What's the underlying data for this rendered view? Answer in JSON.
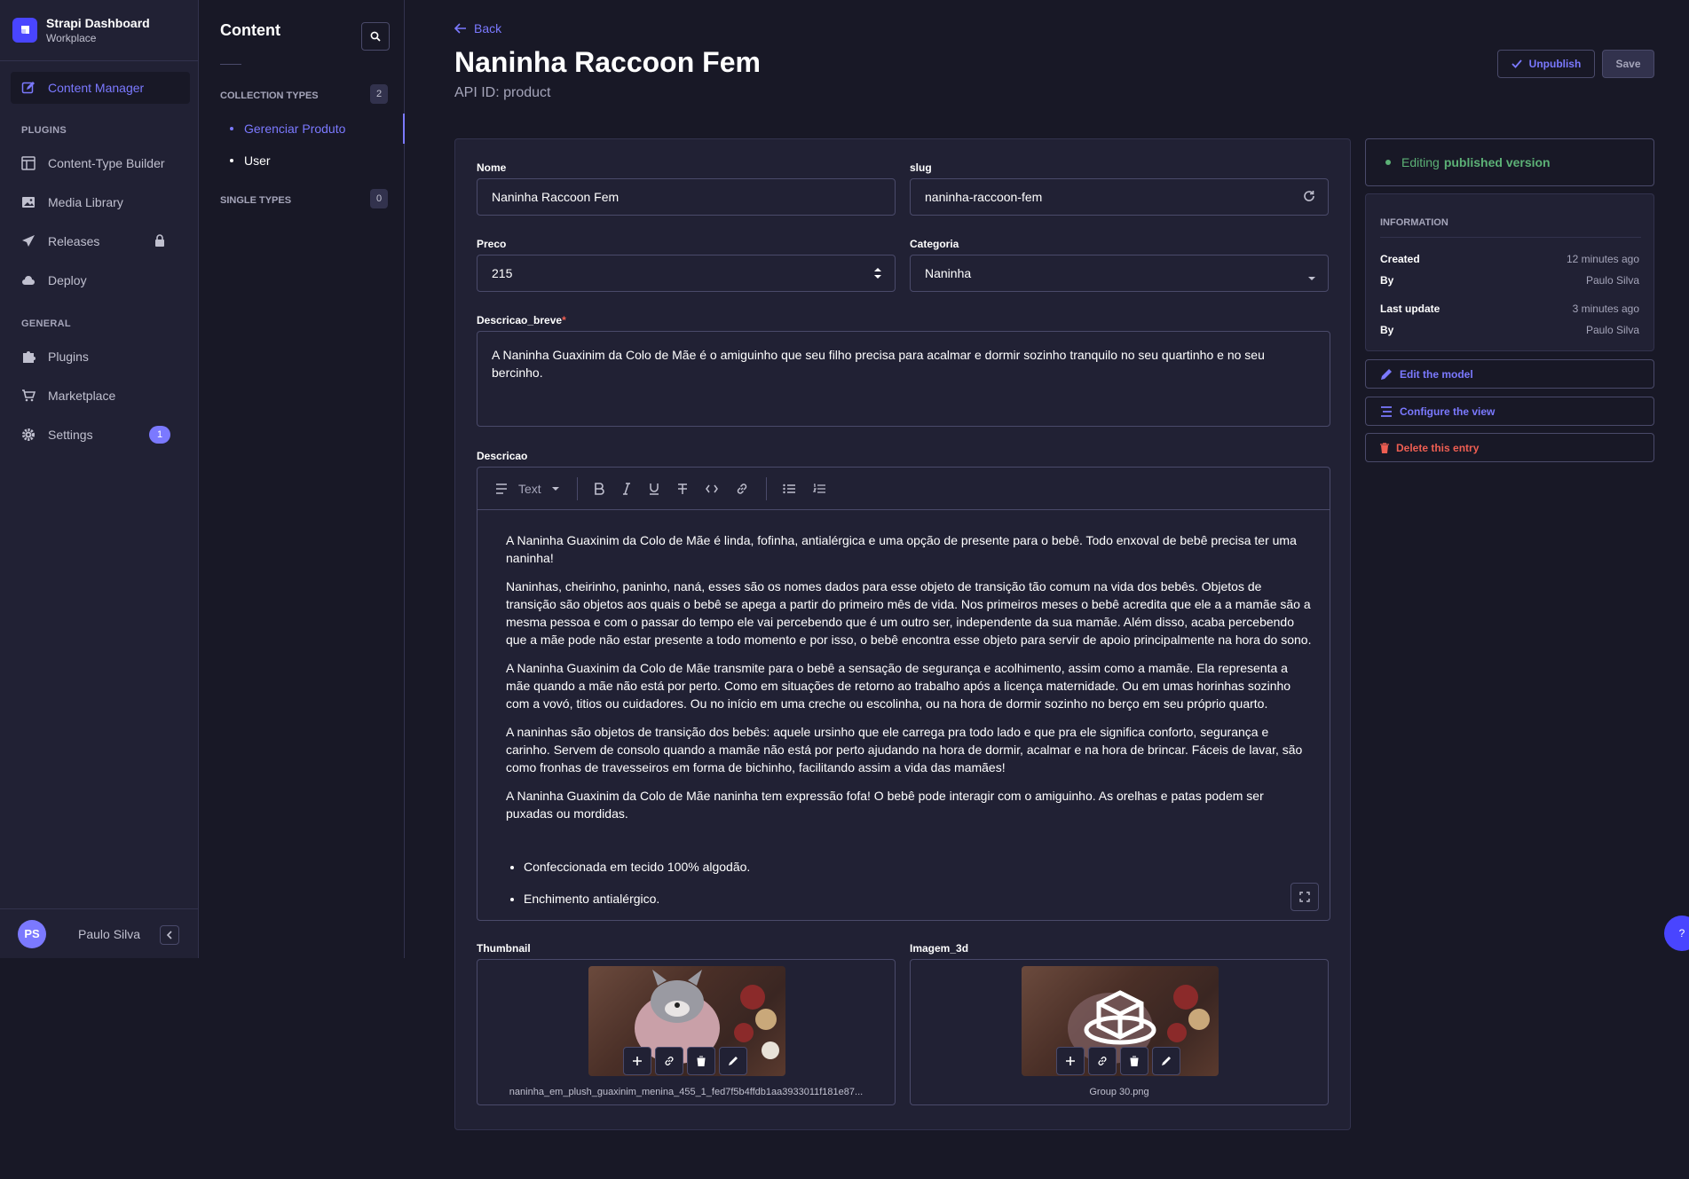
{
  "brand": {
    "title": "Strapi Dashboard",
    "subtitle": "Workplace"
  },
  "mainnav": {
    "content_manager": "Content Manager",
    "plugins_section": "PLUGINS",
    "ctb": "Content-Type Builder",
    "media": "Media Library",
    "releases": "Releases",
    "deploy": "Deploy",
    "general_section": "GENERAL",
    "plugins": "Plugins",
    "marketplace": "Marketplace",
    "settings": "Settings",
    "settings_badge": "1",
    "user_initials": "PS",
    "user_name": "Paulo Silva"
  },
  "subnav": {
    "title": "Content",
    "collection_types": "COLLECTION TYPES",
    "collection_count": "2",
    "items": [
      "Gerenciar Produto",
      "User"
    ],
    "single_types": "SINGLE TYPES",
    "single_count": "0"
  },
  "header": {
    "back": "Back",
    "title": "Naninha Raccoon Fem",
    "api_id": "API ID: product",
    "unpublish": "Unpublish",
    "save": "Save"
  },
  "form": {
    "nome_label": "Nome",
    "nome_value": "Naninha Raccoon Fem",
    "slug_label": "slug",
    "slug_value": "naninha-raccoon-fem",
    "preco_label": "Preco",
    "preco_value": "215",
    "categoria_label": "Categoria",
    "categoria_value": "Naninha",
    "descricao_breve_label": "Descricao_breve",
    "required_mark": "*",
    "descricao_breve_value": "A Naninha Guaxinim da Colo de Mãe é o amiguinho que seu filho precisa para acalmar e dormir sozinho tranquilo no seu quartinho e no seu bercinho.",
    "descricao_label": "Descricao",
    "toolbar_text": "Text",
    "paragraphs": [
      "A Naninha Guaxinim da Colo de Mãe é linda, fofinha, antialérgica e uma opção de presente para o bebê. Todo enxoval de bebê precisa ter uma naninha!",
      "Naninhas, cheirinho, paninho, naná, esses são os nomes dados para esse objeto de transição tão comum na vida dos bebês. Objetos de transição são objetos aos quais o bebê se apega a partir do primeiro mês de vida. Nos primeiros meses o bebê acredita que ele a a mamãe são a mesma pessoa e com o passar do tempo ele vai percebendo que é um outro ser, independente da sua mamãe. Além disso, acaba percebendo que a mãe pode não estar presente a todo momento e por isso, o bebê encontra esse objeto para servir de apoio principalmente na hora do sono.",
      "A Naninha Guaxinim da Colo de Mãe transmite para o bebê a sensação de segurança e acolhimento, assim como a mamãe. Ela representa a mãe quando a mãe não está por perto. Como em situações de retorno ao trabalho após a licença maternidade. Ou em umas horinhas sozinho com a vovó, titios ou cuidadores. Ou no início em uma creche ou escolinha, ou na hora de dormir sozinho no berço em seu próprio quarto.",
      "A naninhas são objetos de transição dos bebês: aquele ursinho que ele carrega pra todo lado e que pra ele significa conforto, segurança e carinho. Servem de consolo quando a mamãe não está por perto ajudando na hora de dormir, acalmar e na hora de brincar. Fáceis de lavar, são como fronhas de travesseiros em forma de bichinho, facilitando assim a vida das mamães!",
      "A Naninha Guaxinim da Colo de Mãe naninha tem expressão fofa! O bebê pode interagir com o amiguinho. As orelhas e patas podem ser puxadas ou mordidas."
    ],
    "bullets": [
      "Confeccionada em tecido 100% algodão.",
      "Enchimento antialérgico."
    ],
    "thumbnail_label": "Thumbnail",
    "thumbnail_name": "naninha_em_plush_guaxinim_menina_455_1_fed7f5b4ffdb1aa3933011f181e87...",
    "imagem3d_label": "Imagem_3d",
    "imagem3d_name": "Group 30.png"
  },
  "side": {
    "status_prefix": "Editing",
    "status_strong": "published version",
    "info_title": "INFORMATION",
    "created_label": "Created",
    "created_value": "12 minutes ago",
    "by_label": "By",
    "created_by": "Paulo Silva",
    "updated_label": "Last update",
    "updated_value": "3 minutes ago",
    "updated_by": "Paulo Silva",
    "edit_model": "Edit the model",
    "configure_view": "Configure the view",
    "delete_entry": "Delete this entry"
  },
  "help": "?"
}
